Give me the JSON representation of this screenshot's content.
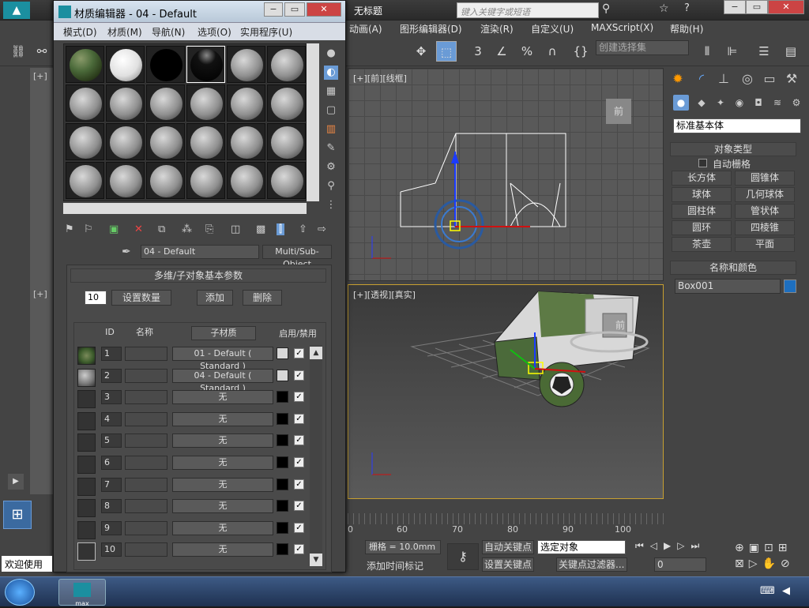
{
  "app": {
    "title": "无标题",
    "search_placeholder": "键入关键字或短语",
    "menus": [
      "动画(A)",
      "图形编辑器(D)",
      "渲染(R)",
      "自定义(U)",
      "MAXScript(X)",
      "帮助(H)"
    ],
    "toolbar": {
      "selection_set_placeholder": "创建选择集"
    }
  },
  "viewports": {
    "front": {
      "label": "[+][前][线框]",
      "viewcube": "前"
    },
    "perspective": {
      "label": "[+][透视][真实]",
      "viewcube": "前"
    },
    "left_top_label": "[+]",
    "left_bottom_label": "[+]"
  },
  "command_panel": {
    "category_dropdown": "标准基本体",
    "object_type_header": "对象类型",
    "auto_grid_label": "自动栅格",
    "buttons": [
      "长方体",
      "圆锥体",
      "球体",
      "几何球体",
      "圆柱体",
      "管状体",
      "圆环",
      "四棱锥",
      "茶壶",
      "平面"
    ],
    "name_color_header": "名称和颜色",
    "object_name": "Box001",
    "object_color": "#1e6fbf"
  },
  "material_editor": {
    "title": "材质编辑器 - 04 - Default",
    "menus": [
      "模式(D)",
      "材质(M)",
      "导航(N)",
      "选项(O)",
      "实用程序(U)"
    ],
    "material_name": "04 - Default",
    "material_type": "Multi/Sub-Object",
    "rollout_title": "多维/子对象基本参数",
    "count_value": "10",
    "set_count_label": "设置数量",
    "add_label": "添加",
    "delete_label": "删除",
    "columns": {
      "id": "ID",
      "name": "名称",
      "sub_material": "子材质",
      "enable": "启用/禁用"
    },
    "rows": [
      {
        "id": "1",
        "sub": "01 - Default ( Standard )",
        "color": "#d8d8d8",
        "thumb": "camo"
      },
      {
        "id": "2",
        "sub": "04 - Default ( Standard )",
        "color": "#d8d8d8",
        "thumb": "grey"
      },
      {
        "id": "3",
        "sub": "无",
        "color": "#000000",
        "thumb": ""
      },
      {
        "id": "4",
        "sub": "无",
        "color": "#000000",
        "thumb": ""
      },
      {
        "id": "5",
        "sub": "无",
        "color": "#000000",
        "thumb": ""
      },
      {
        "id": "6",
        "sub": "无",
        "color": "#000000",
        "thumb": ""
      },
      {
        "id": "7",
        "sub": "无",
        "color": "#000000",
        "thumb": ""
      },
      {
        "id": "8",
        "sub": "无",
        "color": "#000000",
        "thumb": ""
      },
      {
        "id": "9",
        "sub": "无",
        "color": "#000000",
        "thumb": ""
      },
      {
        "id": "10",
        "sub": "无",
        "color": "#000000",
        "thumb": ""
      }
    ]
  },
  "timeline": {
    "ticks": [
      "0",
      "60",
      "70",
      "80",
      "90",
      "100"
    ]
  },
  "status": {
    "grid_label": "栅格 = 10.0mm",
    "auto_key": "自动关键点",
    "selected_object": "选定对象",
    "set_key": "设置关键点",
    "key_filters": "关键点过滤器...",
    "add_time_tag": "添加时间标记",
    "frame_value": "0",
    "welcome": "欢迎使用"
  },
  "taskbar": {
    "app_label": "max"
  }
}
